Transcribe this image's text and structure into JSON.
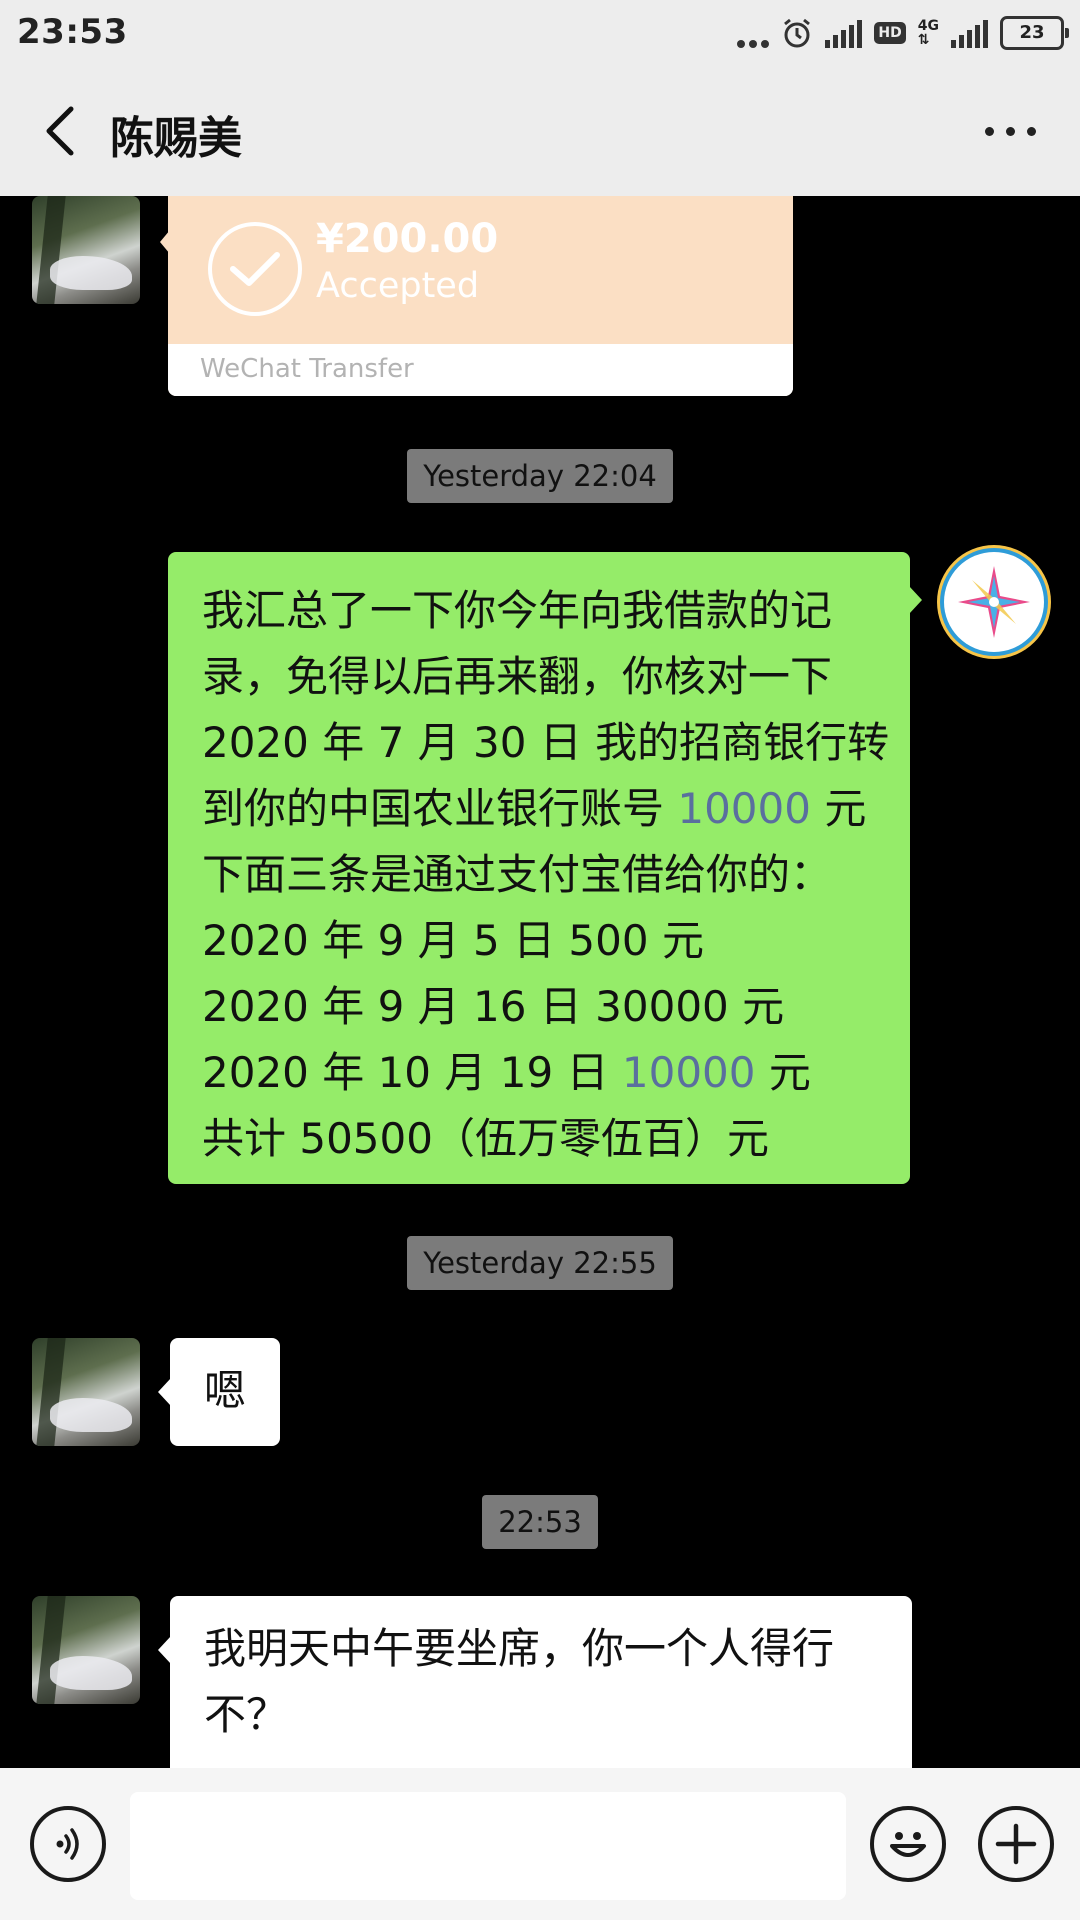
{
  "status_bar": {
    "time": "23:53",
    "network": "4G",
    "hd": "HD",
    "battery": "23"
  },
  "header": {
    "title": "陈赐美",
    "back_icon": "chevron-left-icon",
    "more_icon": "more-dots-icon"
  },
  "messages": {
    "transfer": {
      "amount": "¥200.00",
      "status": "Accepted",
      "label": "WeChat Transfer"
    },
    "timestamp_1": "Yesterday 22:04",
    "sent_message": {
      "line1": "我汇总了一下你今年向我借款的记",
      "line2": "录，免得以后再来翻，你核对一下",
      "line3": "2020 年 7 月 30 日 我的招商银行转",
      "line4_pre": "到你的中国农业银行账号 ",
      "line4_num": "10000",
      "line4_post": " 元",
      "line5": "下面三条是通过支付宝借给你的：",
      "line6": "2020 年 9 月 5 日 500 元",
      "line7": "2020 年 9 月 16 日 30000 元",
      "line8_pre": "2020 年 10 月 19 日 ",
      "line8_num": "10000",
      "line8_post": " 元",
      "line9": "共计 50500（伍万零伍百）元"
    },
    "timestamp_2": "Yesterday 22:55",
    "received_1": "嗯",
    "timestamp_3": "22:53",
    "received_2_line1": "我明天中午要坐席，你一个人得行",
    "received_2_line2": "不？"
  },
  "input_bar": {
    "voice_icon": "voice-icon",
    "emoji_icon": "emoji-icon",
    "plus_icon": "plus-icon",
    "placeholder": ""
  },
  "colors": {
    "sent_bubble": "#95ec69",
    "received_bubble": "#ffffff",
    "transfer_card": "#fbdfc4",
    "chat_background": "#000000",
    "link_number": "#5a6f9e"
  }
}
